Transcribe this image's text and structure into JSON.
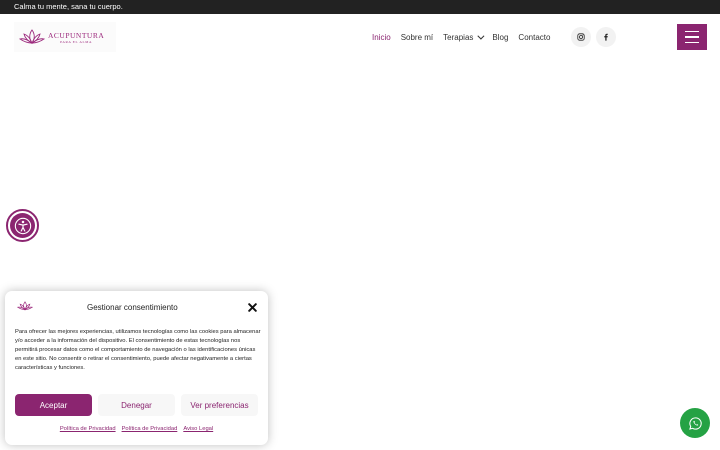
{
  "topbar": {
    "text": "Calma tu mente, sana tu cuerpo."
  },
  "logo": {
    "name": "ACUPUNTURA",
    "sub": "PARA EL ALMA"
  },
  "nav": {
    "items": [
      {
        "label": "Inicio",
        "active": true
      },
      {
        "label": "Sobre mí"
      },
      {
        "label": "Terapias",
        "has_dropdown": true
      },
      {
        "label": "Blog"
      },
      {
        "label": "Contacto"
      }
    ]
  },
  "social": [
    {
      "icon": "instagram-icon"
    },
    {
      "icon": "facebook-icon"
    }
  ],
  "consent": {
    "title": "Gestionar consentimiento",
    "body": "Para ofrecer las mejores experiencias, utilizamos tecnologías como las cookies para almacenar y/o acceder a la información del dispositivo. El consentimiento de estas tecnologías nos permitirá procesar datos como el comportamiento de navegación o las identificaciones únicas en este sitio. No consentir o retirar el consentimiento, puede afectar negativamente a ciertas características y funciones.",
    "accept_label": "Aceptar",
    "deny_label": "Denegar",
    "prefs_label": "Ver preferencias",
    "links": [
      "Política de Privacidad",
      "Política de Privacidad",
      "Aviso Legal"
    ]
  },
  "colors": {
    "accent": "#8b2570",
    "topbar": "#222222",
    "whatsapp": "#25a244"
  }
}
